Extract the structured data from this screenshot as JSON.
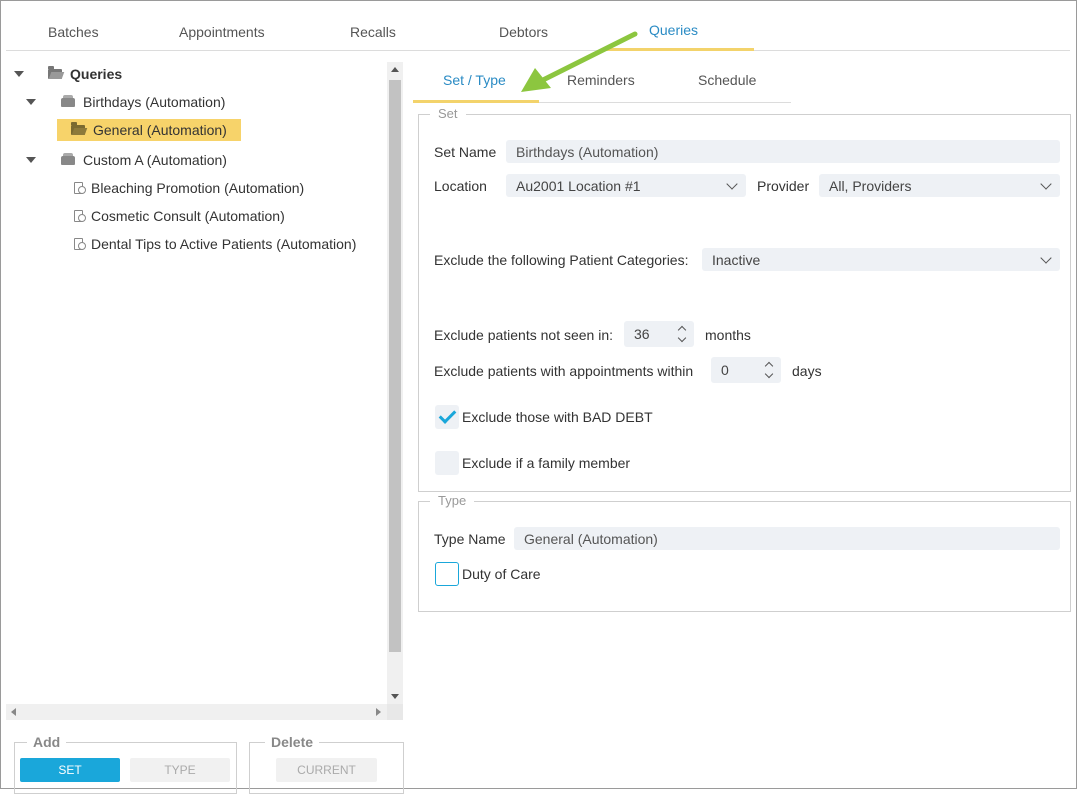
{
  "top_tabs": [
    "Batches",
    "Appointments",
    "Recalls",
    "Debtors",
    "Queries"
  ],
  "active_top_tab": "Queries",
  "tree": {
    "root": "Queries",
    "items": [
      {
        "label": "Birthdays (Automation)"
      },
      {
        "label": "General (Automation)"
      },
      {
        "label": "Custom A (Automation)"
      },
      {
        "label": "Bleaching Promotion (Automation)"
      },
      {
        "label": "Cosmetic Consult (Automation)"
      },
      {
        "label": "Dental Tips to Active Patients (Automation)"
      }
    ]
  },
  "add_group": {
    "legend": "Add",
    "set_label": "SET",
    "type_label": "TYPE"
  },
  "delete_group": {
    "legend": "Delete",
    "current_label": "CURRENT"
  },
  "sub_tabs": [
    "Set / Type",
    "Reminders",
    "Schedule"
  ],
  "active_sub_tab": "Set / Type",
  "set_section": {
    "legend": "Set",
    "set_name_label": "Set Name",
    "set_name_value": "Birthdays (Automation)",
    "location_label": "Location",
    "location_value": "Au2001 Location #1",
    "provider_label": "Provider",
    "provider_value": "All, Providers",
    "exclude_categories_label": "Exclude the following Patient Categories:",
    "exclude_categories_value": "Inactive",
    "not_seen_label": "Exclude patients not seen in:",
    "not_seen_value": "36",
    "not_seen_unit": "months",
    "appt_within_label": "Exclude patients with appointments within",
    "appt_within_value": "0",
    "appt_within_unit": "days",
    "bad_debt_label": "Exclude those with BAD DEBT",
    "family_label": "Exclude if a family member"
  },
  "type_section": {
    "legend": "Type",
    "type_name_label": "Type Name",
    "type_name_value": "General (Automation)",
    "duty_label": "Duty of Care"
  },
  "colors": {
    "accent": "#1aa7da",
    "highlight": "#f7d36a",
    "tab_active": "#2a8bc4",
    "annotation_arrow": "#8cc63f"
  }
}
